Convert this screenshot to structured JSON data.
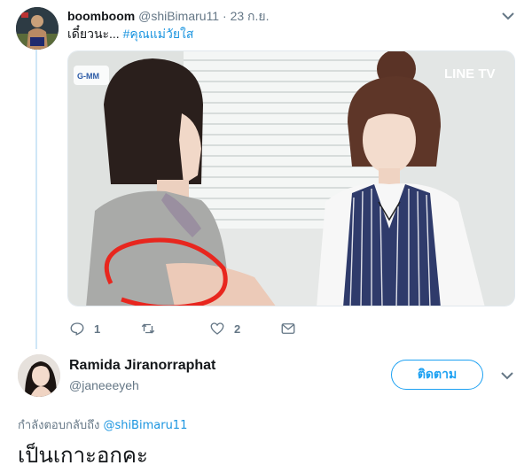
{
  "thread": {
    "original_tweet": {
      "display_name": "boomboom",
      "handle": "@shiBimaru11",
      "separator": "·",
      "date": "23 ก.ย.",
      "text_prefix": "เดี๋ยวนะ...",
      "hashtag": "#คุณแม่วัยใส",
      "media": {
        "channel_badge": "G-MM",
        "watermark": "LINE TV"
      },
      "actions": {
        "reply_count": "1",
        "retweet_count": "",
        "like_count": "2"
      }
    },
    "reply_tweet": {
      "display_name": "Ramida Jiranorraphat",
      "handle": "@janeeeyeh",
      "follow_label": "ติดตาม",
      "replying_to_label": "กำลังตอบกลับถึง",
      "replying_to_handle": "@shiBimaru11",
      "text": "เป็นเกาะอกคะ"
    }
  },
  "colors": {
    "link": "#1b95e0",
    "follow": "#1da1f2",
    "muted": "#657786",
    "thread_line": "#cfe7f7"
  }
}
